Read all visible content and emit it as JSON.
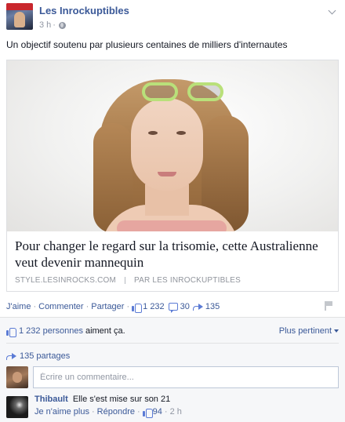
{
  "header": {
    "page_name": "Les Inrockuptibles",
    "time": "3 h",
    "meta_sep": "·"
  },
  "post": {
    "text": "Un objectif soutenu par plusieurs centaines de milliers d'internautes"
  },
  "link": {
    "title": "Pour changer le regard sur la trisomie, cette Australienne veut devenir mannequin",
    "domain": "STYLE.LESINROCKS.COM",
    "byline": "PAR LES INROCKUPTIBLES"
  },
  "actions": {
    "like": "J'aime",
    "comment": "Commenter",
    "share": "Partager",
    "dot": "·",
    "like_count": "1 232",
    "comment_count": "30",
    "share_count": "135"
  },
  "feedback": {
    "likes_link": "1 232 personnes",
    "likes_text": "aiment ça.",
    "sort_label": "Plus pertinent",
    "shares": "135 partages",
    "compose_placeholder": "Écrire un commentaire..."
  },
  "comment": {
    "author": "Thibault",
    "text": "Elle s'est mise sur son 21",
    "unlike": "Je n'aime plus",
    "reply": "Répondre",
    "likes": "94",
    "time": "2 h",
    "dot": "·"
  },
  "colors": {
    "link_blue": "#3b5998",
    "meta_grey": "#9197a3",
    "feedback_bg": "#f6f7f9",
    "icon_blue": "#5b7bd5"
  }
}
